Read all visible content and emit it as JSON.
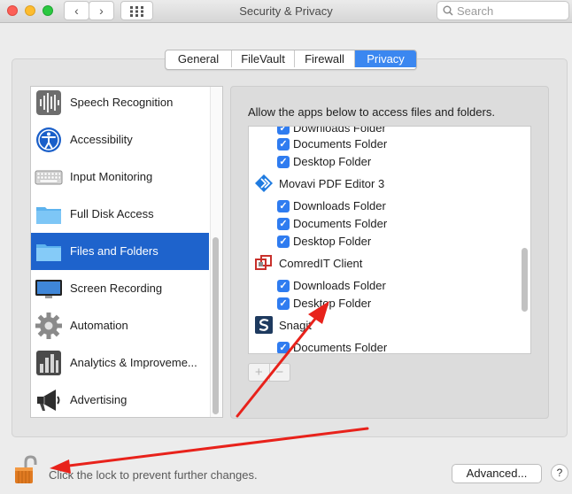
{
  "window": {
    "title": "Security & Privacy",
    "nav_back": "‹",
    "nav_forward": "›",
    "grid_icon": "grid-icon"
  },
  "search": {
    "placeholder": "Search"
  },
  "tabs": [
    {
      "label": "General",
      "active": false
    },
    {
      "label": "FileVault",
      "active": false
    },
    {
      "label": "Firewall",
      "active": false
    },
    {
      "label": "Privacy",
      "active": true
    }
  ],
  "categories": [
    {
      "label": "Speech Recognition",
      "icon": "waveform-icon"
    },
    {
      "label": "Accessibility",
      "icon": "accessibility-icon"
    },
    {
      "label": "Input Monitoring",
      "icon": "keyboard-icon"
    },
    {
      "label": "Full Disk Access",
      "icon": "folder-icon"
    },
    {
      "label": "Files and Folders",
      "icon": "folder-icon",
      "selected": true
    },
    {
      "label": "Screen Recording",
      "icon": "display-icon"
    },
    {
      "label": "Automation",
      "icon": "gear-icon"
    },
    {
      "label": "Analytics & Improveme...",
      "icon": "analytics-icon"
    },
    {
      "label": "Advertising",
      "icon": "megaphone-icon"
    }
  ],
  "right_panel": {
    "description": "Allow the apps below to access files and folders.",
    "rows": [
      {
        "type": "perm",
        "label": "Downloads Folder"
      },
      {
        "type": "perm",
        "label": "Documents Folder"
      },
      {
        "type": "perm",
        "label": "Desktop Folder"
      },
      {
        "type": "app",
        "label": "Movavi PDF Editor 3",
        "icon": "movavi-icon"
      },
      {
        "type": "perm",
        "label": "Downloads Folder"
      },
      {
        "type": "perm",
        "label": "Documents Folder"
      },
      {
        "type": "perm",
        "label": "Desktop Folder"
      },
      {
        "type": "app",
        "label": "ComredIT Client",
        "icon": "comredit-icon"
      },
      {
        "type": "perm",
        "label": "Downloads Folder"
      },
      {
        "type": "perm",
        "label": "Desktop Folder"
      },
      {
        "type": "app",
        "label": "Snagit",
        "icon": "snagit-icon"
      },
      {
        "type": "perm",
        "label": "Documents Folder"
      }
    ],
    "checkmark": "✓",
    "add_label": "+",
    "remove_label": "−"
  },
  "footer": {
    "lock_text": "Click the lock to prevent further changes.",
    "advanced_label": "Advanced...",
    "help_label": "?"
  },
  "colors": {
    "accent": "#3b87f0",
    "selection": "#1e63cc",
    "annotation_arrow": "#e8221b"
  }
}
